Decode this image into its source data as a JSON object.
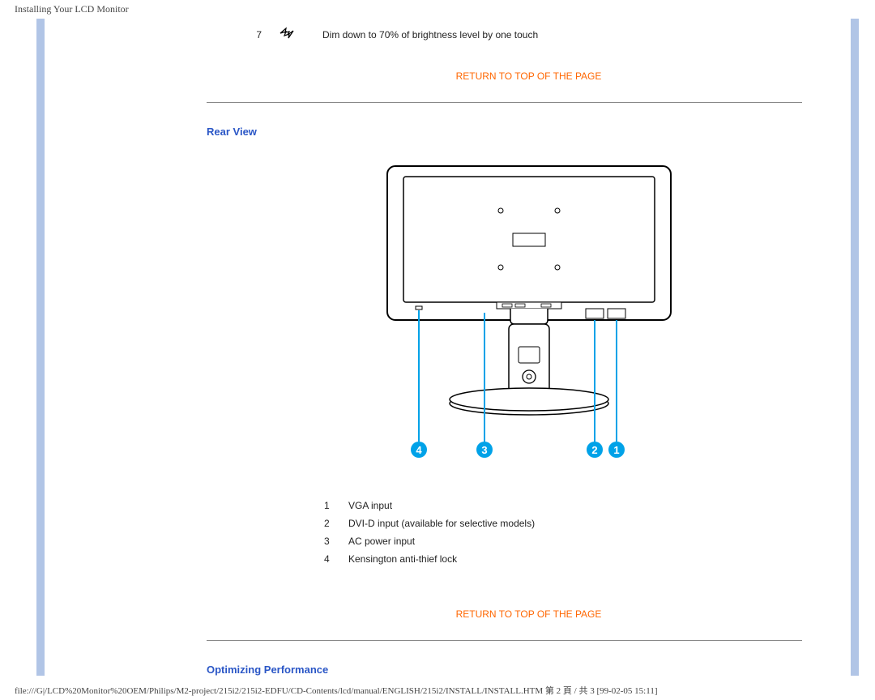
{
  "header": {
    "title": "Installing Your LCD Monitor"
  },
  "feature_row": {
    "number": "7",
    "description": "Dim down to 70% of brightness level by one touch"
  },
  "links": {
    "return_top_1": "RETURN TO TOP OF THE PAGE",
    "return_top_2": "RETURN TO TOP OF THE PAGE"
  },
  "sections": {
    "rear_view": "Rear View",
    "optimizing_performance": "Optimizing Performance"
  },
  "rear_connectors": [
    {
      "num": "1",
      "label": "VGA input"
    },
    {
      "num": "2",
      "label": "DVI-D input (available for selective models)"
    },
    {
      "num": "3",
      "label": "AC power input"
    },
    {
      "num": "4",
      "label": "Kensington anti-thief lock"
    }
  ],
  "callouts": [
    "4",
    "3",
    "2",
    "1"
  ],
  "footer": {
    "path": "file:///G|/LCD%20Monitor%20OEM/Philips/M2-project/215i2/215i2-EDFU/CD-Contents/lcd/manual/ENGLISH/215i2/INSTALL/INSTALL.HTM 第 2 頁 / 共 3  [99-02-05 15:11]"
  }
}
